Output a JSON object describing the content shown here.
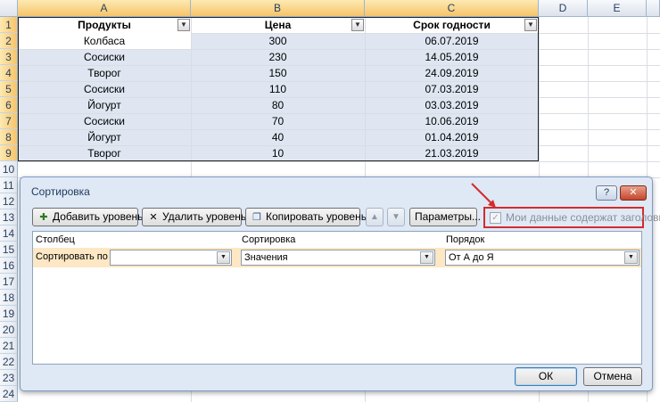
{
  "sheet": {
    "columns": [
      "A",
      "B",
      "C",
      "D",
      "E"
    ],
    "rows": [
      "1",
      "2",
      "3",
      "4",
      "5",
      "6",
      "7",
      "8",
      "9",
      "10",
      "11",
      "12",
      "13",
      "14",
      "15",
      "16",
      "17",
      "18",
      "19",
      "20",
      "21",
      "22",
      "23",
      "24"
    ],
    "table": {
      "headers": [
        "Продукты",
        "Цена",
        "Срок годности"
      ],
      "data": [
        [
          "Колбаса",
          "300",
          "06.07.2019"
        ],
        [
          "Сосиски",
          "230",
          "14.05.2019"
        ],
        [
          "Творог",
          "150",
          "24.09.2019"
        ],
        [
          "Сосиски",
          "110",
          "07.03.2019"
        ],
        [
          "Йогурт",
          "80",
          "03.03.2019"
        ],
        [
          "Сосиски",
          "70",
          "10.06.2019"
        ],
        [
          "Йогурт",
          "40",
          "01.04.2019"
        ],
        [
          "Творог",
          "10",
          "21.03.2019"
        ]
      ]
    }
  },
  "dialog": {
    "title": "Сортировка",
    "help_glyph": "?",
    "close_glyph": "✕",
    "toolbar": {
      "add_level": "Добавить уровень",
      "delete_level": "Удалить уровень",
      "copy_level": "Копировать уровень",
      "move_up_glyph": "▲",
      "move_down_glyph": "▼",
      "options": "Параметры...",
      "headers_checkbox": "Мои данные содержат заголовки",
      "headers_checked": true
    },
    "columns": {
      "column": "Столбец",
      "sort_on": "Сортировка",
      "order": "Порядок"
    },
    "level": {
      "label": "Сортировать по",
      "column_value": "",
      "sort_on_value": "Значения",
      "order_value": "От А до Я"
    },
    "ok": "ОК",
    "cancel": "Отмена",
    "highlight_color": "#d22c2c"
  }
}
